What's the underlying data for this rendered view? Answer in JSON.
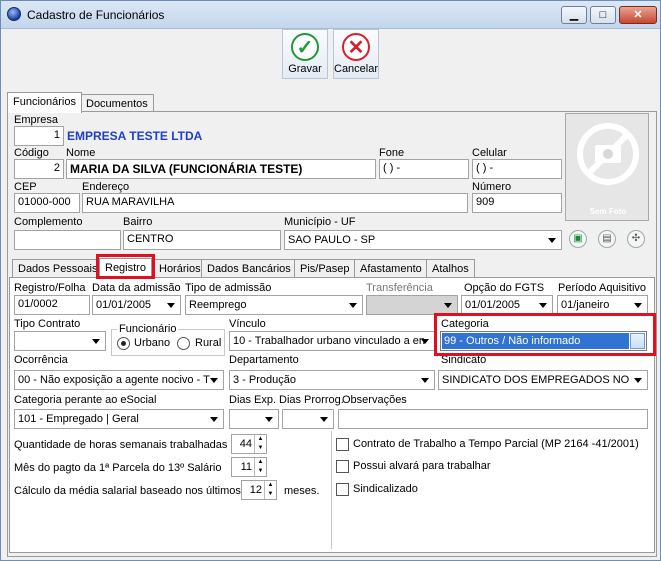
{
  "window": {
    "title": "Cadastro de Funcionários",
    "minimize": "▁",
    "maximize": "□",
    "close": "✕"
  },
  "toolbar": {
    "save_label": "Gravar",
    "cancel_label": "Cancelar"
  },
  "top_tabs": [
    "Funcionários",
    "Documentos"
  ],
  "empresa": {
    "label": "Empresa",
    "code": "1",
    "name": "EMPRESA TESTE LTDA"
  },
  "codigo": {
    "label": "Código",
    "value": "2"
  },
  "nome": {
    "label": "Nome",
    "value": "MARIA DA SILVA (FUNCIONÁRIA TESTE)"
  },
  "fone": {
    "label": "Fone",
    "value": "(  )      -"
  },
  "celular": {
    "label": "Celular",
    "value": "(  )      -"
  },
  "cep": {
    "label": "CEP",
    "value": "01000-000"
  },
  "endereco": {
    "label": "Endereço",
    "value": "RUA MARAVILHA"
  },
  "numero": {
    "label": "Número",
    "value": "909"
  },
  "complemento": {
    "label": "Complemento",
    "value": ""
  },
  "bairro": {
    "label": "Bairro",
    "value": "CENTRO"
  },
  "municipio": {
    "label": "Município - UF",
    "value": "SAO PAULO - SP"
  },
  "photo": {
    "caption": "Sem Foto"
  },
  "inner_tabs": [
    "Dados Pessoais",
    "Registro",
    "Horários",
    "Dados Bancários",
    "Pis/Pasep",
    "Afastamento",
    "Atalhos"
  ],
  "registro": {
    "registro_folha": {
      "label": "Registro/Folha",
      "value": "01/0002"
    },
    "data_admissao": {
      "label": "Data da admissão",
      "value": "01/01/2005"
    },
    "tipo_admissao": {
      "label": "Tipo de admissão",
      "value": "Reemprego"
    },
    "transferencia": {
      "label": "Transferência",
      "value": ""
    },
    "opcao_fgts": {
      "label": "Opção do FGTS",
      "value": "01/01/2005"
    },
    "periodo_aquisitivo": {
      "label": "Período Aquisitivo",
      "value": "01/janeiro"
    },
    "tipo_contrato": {
      "label": "Tipo Contrato",
      "value": ""
    },
    "funcionario": {
      "label": "Funcionário",
      "urbano": "Urbano",
      "rural": "Rural"
    },
    "vinculo": {
      "label": "Vínculo",
      "value": "10 - Trabalhador urbano vinculado a en"
    },
    "categoria": {
      "label": "Categoria",
      "value": "99 - Outros / Não informado"
    },
    "ocorrencia": {
      "label": "Ocorrência",
      "value": "00 - Não exposição a agente nocivo - T"
    },
    "departamento": {
      "label": "Departamento",
      "value": "3 - Produção"
    },
    "sindicato": {
      "label": "Sindicato",
      "value": "SINDICATO DOS EMPREGADOS NO"
    },
    "categoria_esocial": {
      "label": "Categoria perante ao eSocial",
      "value": "101 - Empregado | Geral"
    },
    "dias_exp": {
      "label": "Dias Exp.",
      "value": ""
    },
    "dias_prorrog": {
      "label": "Dias Prorrog.",
      "value": ""
    },
    "observacoes": {
      "label": "Observações"
    },
    "horas_semanais": {
      "label": "Quantidade de horas semanais trabalhadas",
      "value": "44"
    },
    "mes_pagto": {
      "label": "Mês do pagto da 1ª Parcela do 13º Salário",
      "value": "11"
    },
    "media_salarial": {
      "label": "Cálculo da média salarial baseado nos últimos",
      "value": "12",
      "suffix": "meses."
    },
    "contrato_parcial": "Contrato de Trabalho a Tempo Parcial (MP 2164 -41/2001)",
    "alvara": "Possui alvará para trabalhar",
    "sindicalizado": "Sindicalizado"
  }
}
